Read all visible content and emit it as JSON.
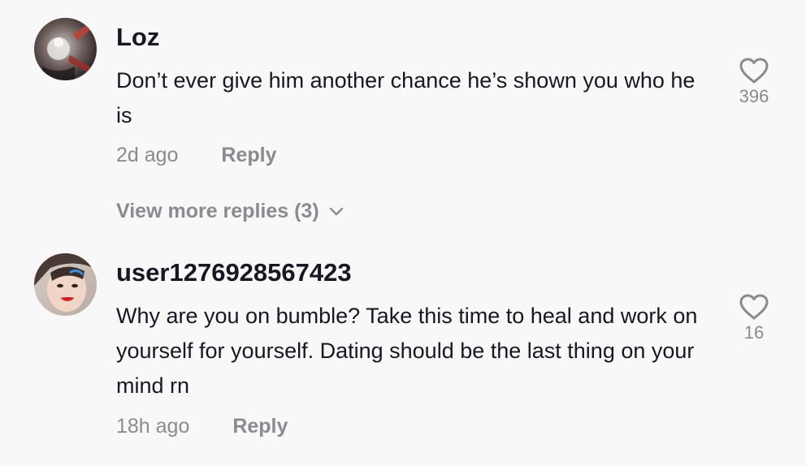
{
  "comments": [
    {
      "username": "Loz",
      "text": "Don’t ever give him another chance he’s shown you who he is",
      "time": "2d ago",
      "reply_label": "Reply",
      "likes": "396",
      "avatar_icon": "avatar-dark-photo"
    },
    {
      "username": "user1276928567423",
      "text": "Why are you on bumble? Take this time to heal and work on yourself for yourself. Dating should be the last thing on your mind rn",
      "time": "18h ago",
      "reply_label": "Reply",
      "likes": "16",
      "avatar_icon": "avatar-portrait-photo"
    }
  ],
  "view_more": {
    "label": "View more replies (3)",
    "icon": "chevron-down-icon"
  },
  "colors": {
    "background": "#f8f8f8",
    "primary_text": "#161823",
    "secondary_text": "#8a8b91"
  }
}
